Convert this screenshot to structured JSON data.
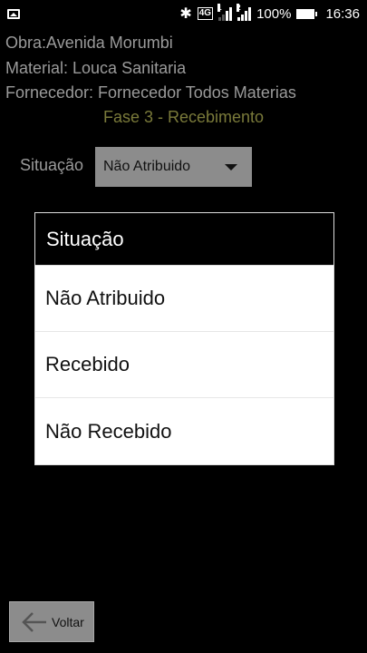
{
  "status_bar": {
    "network_badge": "4G",
    "sim1": "1",
    "sim2": "2",
    "battery": "100%",
    "time": "16:36",
    "icons": [
      "image-icon",
      "bluetooth-icon",
      "signal-icon",
      "battery-icon"
    ]
  },
  "info": {
    "obra": "Obra:Avenida Morumbi",
    "material": "Material: Louca Sanitaria",
    "fornecedor": "Fornecedor: Fornecedor Todos Materias"
  },
  "phase": "Fase 3 - Recebimento",
  "situacao": {
    "label": "Situação",
    "selected": "Não Atribuido"
  },
  "dialog": {
    "title": "Situação",
    "options": [
      "Não Atribuido",
      "Recebido",
      "Não Recebido"
    ]
  },
  "back_button": {
    "label": "Voltar",
    "icon": "arrow-left-icon"
  },
  "colors": {
    "info_text": "#9a9a9a",
    "phase_text": "#7a7a3a",
    "dropdown_bg": "#8c8c8c"
  }
}
